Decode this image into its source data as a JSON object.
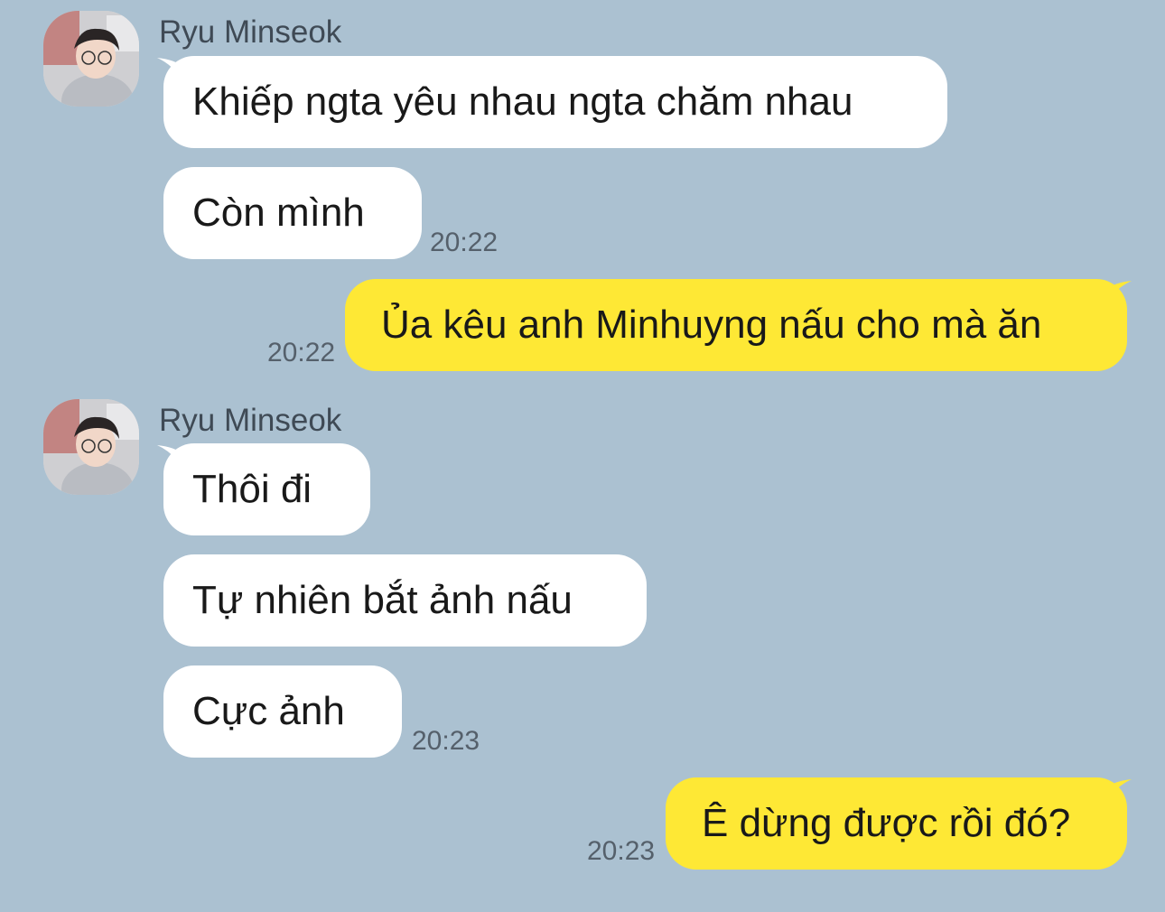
{
  "chat": {
    "colors": {
      "background": "#abc1d1",
      "incoming_bubble": "#ffffff",
      "outgoing_bubble": "#fee835"
    },
    "group1": {
      "sender": "Ryu Minseok",
      "messages": [
        "Khiếp ngta yêu nhau ngta chăm nhau",
        "Còn mình"
      ],
      "time": "20:22"
    },
    "out1": {
      "text": "Ủa kêu anh Minhuyng nấu cho mà ăn",
      "time": "20:22"
    },
    "group2": {
      "sender": "Ryu Minseok",
      "messages": [
        "Thôi đi",
        "Tự nhiên bắt ảnh nấu",
        "Cực ảnh"
      ],
      "time": "20:23"
    },
    "out2": {
      "text": "Ê dừng được rồi đó?",
      "time": "20:23"
    }
  }
}
